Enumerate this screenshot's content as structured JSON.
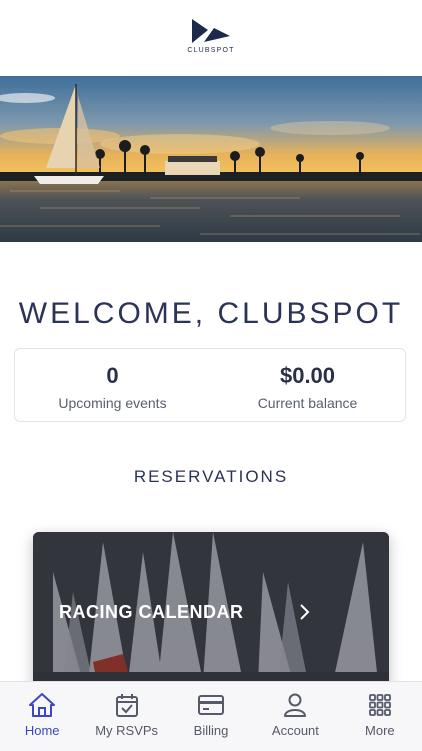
{
  "brand": {
    "name": "CLUBSPOT"
  },
  "welcome": {
    "title": "WELCOME, CLUBSPOT"
  },
  "stats": [
    {
      "value": "0",
      "label": "Upcoming events"
    },
    {
      "value": "$0.00",
      "label": "Current balance"
    }
  ],
  "reservations": {
    "title": "RESERVATIONS",
    "card": {
      "label": "RACING CALENDAR"
    }
  },
  "tabbar": {
    "tabs": [
      {
        "label": "Home",
        "icon": "home-icon",
        "active": true
      },
      {
        "label": "My RSVPs",
        "icon": "calendar-check-icon",
        "active": false
      },
      {
        "label": "Billing",
        "icon": "credit-card-icon",
        "active": false
      },
      {
        "label": "Account",
        "icon": "user-icon",
        "active": false
      },
      {
        "label": "More",
        "icon": "grid-icon",
        "active": false
      }
    ]
  },
  "colors": {
    "accent": "#3b47c4",
    "navy": "#2b3358",
    "inactive": "#55596a"
  }
}
